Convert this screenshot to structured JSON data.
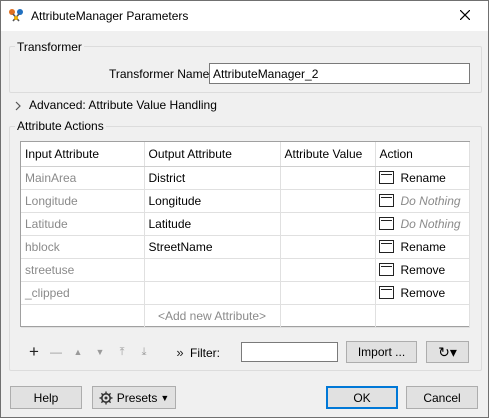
{
  "window": {
    "title": "AttributeManager Parameters",
    "close_icon": "close-icon",
    "app_icon": "fme-transformer-icon"
  },
  "transformer": {
    "group_label": "Transformer",
    "name_label": "Transformer Name:",
    "name_value": "AttributeManager_2"
  },
  "advanced": {
    "label": "Advanced: Attribute Value Handling"
  },
  "attribute_actions": {
    "group_label": "Attribute Actions",
    "columns": [
      "Input Attribute",
      "Output Attribute",
      "Attribute Value",
      "Action"
    ],
    "rows": [
      {
        "input": "MainArea",
        "output": "District",
        "value": "",
        "action": "Rename",
        "muted": false
      },
      {
        "input": "Longitude",
        "output": "Longitude",
        "value": "",
        "action": "Do Nothing",
        "muted": true
      },
      {
        "input": "Latitude",
        "output": "Latitude",
        "value": "",
        "action": "Do Nothing",
        "muted": true
      },
      {
        "input": "hblock",
        "output": "StreetName",
        "value": "",
        "action": "Rename",
        "muted": false
      },
      {
        "input": "streetuse",
        "output": "",
        "value": "",
        "action": "Remove",
        "muted": false
      },
      {
        "input": "_clipped",
        "output": "",
        "value": "",
        "action": "Remove",
        "muted": false
      }
    ],
    "add_new_placeholder": "<Add new Attribute>"
  },
  "toolbar": {
    "add_symbol": "+",
    "remove_symbol": "—",
    "move_up_symbol": "▲",
    "move_down_symbol": "▼",
    "move_top_symbol": "⤒",
    "move_bottom_symbol": "⤓",
    "expand_symbol": "»",
    "filter_label": "Filter:",
    "filter_value": "",
    "import_label": "Import ...",
    "refresh_symbol": "↻▾"
  },
  "footer": {
    "help_label": "Help",
    "presets_label": "Presets",
    "ok_label": "OK",
    "cancel_label": "Cancel"
  },
  "colors": {
    "default_button_border": "#0078d7",
    "muted_text": "#8a8a8a"
  }
}
